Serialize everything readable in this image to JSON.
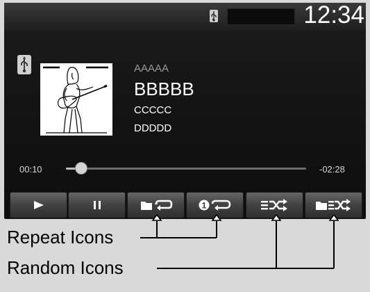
{
  "status": {
    "clock": "12:34",
    "icons": [
      "usb-icon"
    ]
  },
  "track": {
    "source_icon": "usb-icon",
    "album_art": "album-art-guitarist",
    "line_a": "AAAAA",
    "line_b": "BBBBB",
    "line_c": "CCCCC",
    "line_d": "DDDDD"
  },
  "progress": {
    "elapsed": "00:10",
    "remaining": "-02:28",
    "fraction": 0.06
  },
  "controls": [
    {
      "name": "play-button",
      "icon": "play-icon"
    },
    {
      "name": "pause-button",
      "icon": "pause-icon"
    },
    {
      "name": "repeat-folder-button",
      "icon": "folder-repeat-icon"
    },
    {
      "name": "repeat-one-button",
      "icon": "repeat-one-icon"
    },
    {
      "name": "random-list-button",
      "icon": "list-shuffle-icon"
    },
    {
      "name": "random-folder-button",
      "icon": "folder-shuffle-icon"
    }
  ],
  "callouts": {
    "repeat": "Repeat Icons",
    "random": "Random Icons"
  },
  "colors": {
    "display_bg": "#121212",
    "text": "#ffffff",
    "button": "#4a4a4a",
    "page_bg": "#d9d9d9"
  }
}
